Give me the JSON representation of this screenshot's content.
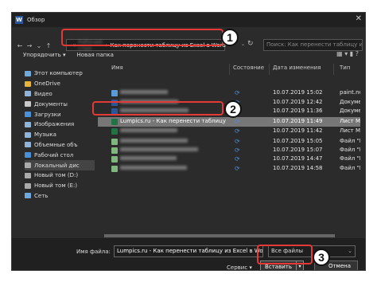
{
  "titlebar": {
    "logo": "W",
    "title": "Обзор",
    "close": "✕"
  },
  "address": {
    "back": "←",
    "forward": "→",
    "dropdown": "⌄",
    "up": "↑",
    "prefix": "«",
    "blurred_segment": "Рабочий стол",
    "path_current": "Как перенести таблицу из Excel в Word",
    "refresh": "↻",
    "search_placeholder": "Поиск: Как перенести таблицу из Excel..."
  },
  "toolbar": {
    "organize": "Упорядочить ▾",
    "new_folder": "Новая папка",
    "view": "▦ ▾  ▮  ?"
  },
  "nav": [
    {
      "label": "Этот компьютер",
      "icon": "computer-icon",
      "color": "#6fa8dc"
    },
    {
      "label": "OneDrive",
      "icon": "folder-icon",
      "color": "#e8b339"
    },
    {
      "label": "Видео",
      "icon": "video-icon",
      "color": "#8fb4d9"
    },
    {
      "label": "Документы",
      "icon": "documents-icon",
      "color": "#c9c9c9"
    },
    {
      "label": "Загрузки",
      "icon": "downloads-icon",
      "color": "#4a90d9"
    },
    {
      "label": "Изображения",
      "icon": "images-icon",
      "color": "#8fb4d9"
    },
    {
      "label": "Музыка",
      "icon": "music-icon",
      "color": "#8fb4d9"
    },
    {
      "label": "Объемные объ",
      "icon": "3d-objects-icon",
      "color": "#8fb4d9"
    },
    {
      "label": "Рабочий стол",
      "icon": "desktop-icon",
      "color": "#4a90d9"
    },
    {
      "label": "Локальный дис",
      "icon": "drive-icon",
      "color": "#aaaaaa",
      "selected": true
    },
    {
      "label": "Новый том (D:)",
      "icon": "drive-icon",
      "color": "#aaaaaa"
    },
    {
      "label": "Новый том (E:)",
      "icon": "drive-icon",
      "color": "#aaaaaa"
    },
    {
      "label": "Сеть",
      "icon": "network-icon",
      "color": "#6fa8dc"
    }
  ],
  "columns": {
    "name": "Имя",
    "status": "Состояние",
    "date": "Дата изменения",
    "type": "Тип"
  },
  "files": [
    {
      "name": "",
      "date": "10.07.2019 15:02",
      "type": "paint.net Image",
      "icon_color": "#5b9bd5",
      "blurred": true
    },
    {
      "name": "",
      "date": "10.07.2019 12:42",
      "type": "Документ Micros",
      "icon_color": "#2b579a",
      "blurred": true
    },
    {
      "name": "",
      "date": "10.07.2019 11:36",
      "type": "Документ Micros",
      "icon_color": "#2b579a",
      "blurred": true
    },
    {
      "name": "Lumpics.ru - Как перенести таблицу из ...",
      "date": "10.07.2019 11:49",
      "type": "Лист Microsoft E",
      "icon_color": "#217346",
      "highlighted": true
    },
    {
      "name": "",
      "date": "10.07.2019 11:42",
      "type": "Лист Microsoft E",
      "icon_color": "#217346",
      "blurred": true
    },
    {
      "name": "",
      "date": "10.07.2019 15:05",
      "type": "Файл \"PNG\"",
      "icon_color": "#7fb77e",
      "blurred": true
    },
    {
      "name": "",
      "date": "10.07.2019 15:07",
      "type": "Файл \"PNG\"",
      "icon_color": "#7fb77e",
      "blurred": true
    },
    {
      "name": "",
      "date": "10.07.2019 14:47",
      "type": "Файл \"PNG\"",
      "icon_color": "#7fb77e",
      "blurred": true
    },
    {
      "name": "",
      "date": "10.07.2019 14:58",
      "type": "Файл \"PNG\"",
      "icon_color": "#7fb77e",
      "blurred": true
    }
  ],
  "bottom": {
    "filename_label": "Имя файла:",
    "filename_value": "Lumpics.ru - Как перенести таблицу из Excel в Word",
    "filter": "Все файлы",
    "service": "Сервис ▾",
    "insert": "Вставить",
    "cancel": "Отмена",
    "dropdown_arrow": "▾"
  },
  "badges": [
    "1",
    "2",
    "3"
  ]
}
